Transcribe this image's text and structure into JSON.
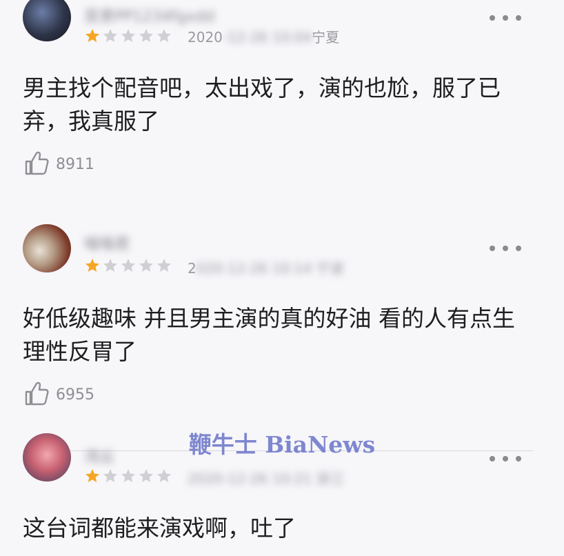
{
  "colors": {
    "star_filled": "#f6a623",
    "star_empty": "#cfcfd4",
    "watermark": "#6a74c8"
  },
  "comments": [
    {
      "username": "昱景PP1234fgxdd",
      "rating": 1,
      "meta_visible": "2020",
      "meta_blurred": "-12-26 10:04",
      "location": "宁夏",
      "text": "男主找个配音吧，太出戏了，演的也尬，服了已弃，我真服了",
      "likes": "8911"
    },
    {
      "username": "喵喵君",
      "rating": 1,
      "meta_visible": "2",
      "meta_blurred": "020-12-26 10:14 宁波",
      "location": "",
      "text": "好低级趣味 并且男主演的真的好油 看的人有点生理性反胃了",
      "likes": "6955"
    },
    {
      "username": "湾云",
      "rating": 1,
      "meta_visible": "",
      "meta_blurred": "2020-12-26 10:21 浙江",
      "location": "",
      "text": "这台词都能来演戏啊，吐了",
      "likes": ""
    }
  ],
  "watermark": "鞭牛士 BiaNews",
  "icons": {
    "more": "more-icon",
    "like": "thumbs-up-icon",
    "star": "star-icon"
  }
}
